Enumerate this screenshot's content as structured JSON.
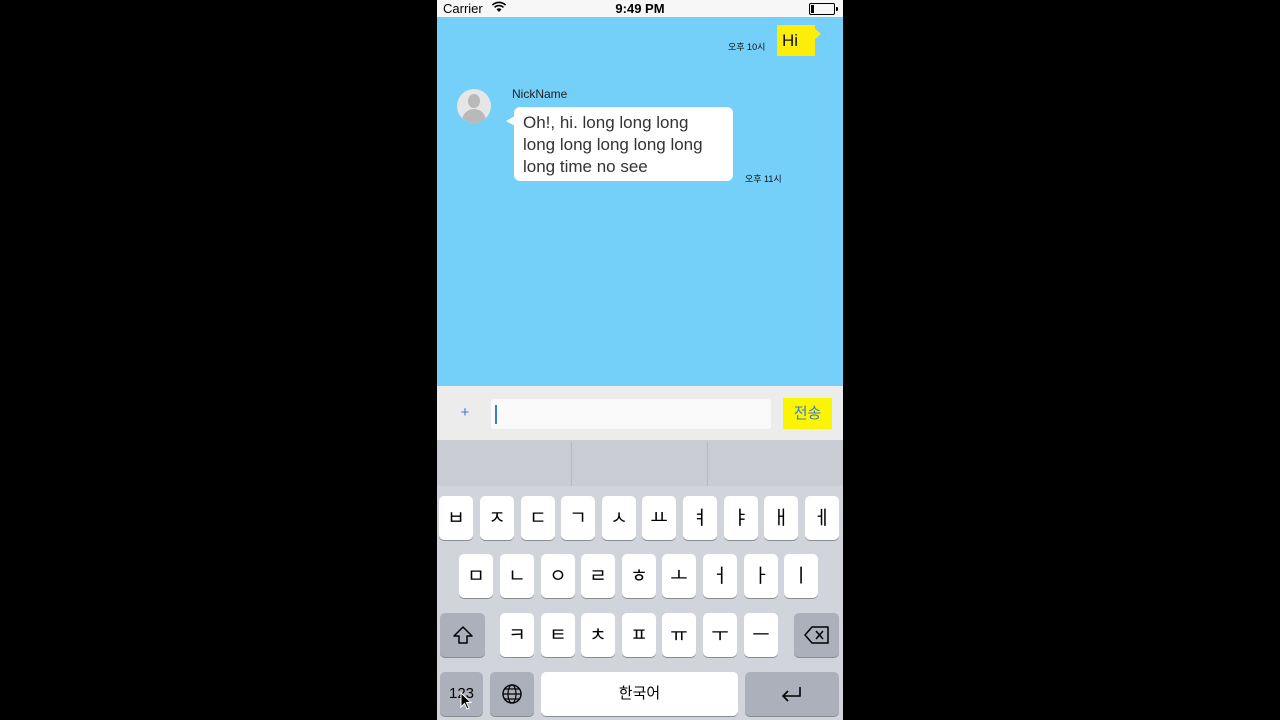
{
  "status_bar": {
    "carrier": "Carrier",
    "time": "9:49 PM"
  },
  "chat": {
    "my_message": {
      "text": "Hi",
      "time": "오후 10시"
    },
    "other_message": {
      "nickname": "NickName",
      "line1": "Oh!, hi. long long long",
      "line2": "long long long long long",
      "line3": "long time no see",
      "time": "오후 11시"
    }
  },
  "input_bar": {
    "plus_label": "+",
    "send_label": "전송",
    "value": "",
    "placeholder": ""
  },
  "keyboard": {
    "row1": [
      "ㅂ",
      "ㅈ",
      "ㄷ",
      "ㄱ",
      "ㅅ",
      "ㅛ",
      "ㅕ",
      "ㅑ",
      "ㅐ",
      "ㅔ"
    ],
    "row2": [
      "ㅁ",
      "ㄴ",
      "ㅇ",
      "ㄹ",
      "ㅎ",
      "ㅗ",
      "ㅓ",
      "ㅏ",
      "ㅣ"
    ],
    "row3": [
      "ㅋ",
      "ㅌ",
      "ㅊ",
      "ㅍ",
      "ㅠ",
      "ㅜ",
      "ㅡ"
    ],
    "numbers_label": "123",
    "space_label": "한국어",
    "icons": {
      "shift": "shift-icon",
      "backspace": "backspace-icon",
      "globe": "globe-icon",
      "return": "return-icon"
    }
  },
  "colors": {
    "chat_background": "#74cff9",
    "my_bubble": "#fcee0a",
    "send_button": "#fcf500",
    "accent": "#3a7bd5"
  }
}
